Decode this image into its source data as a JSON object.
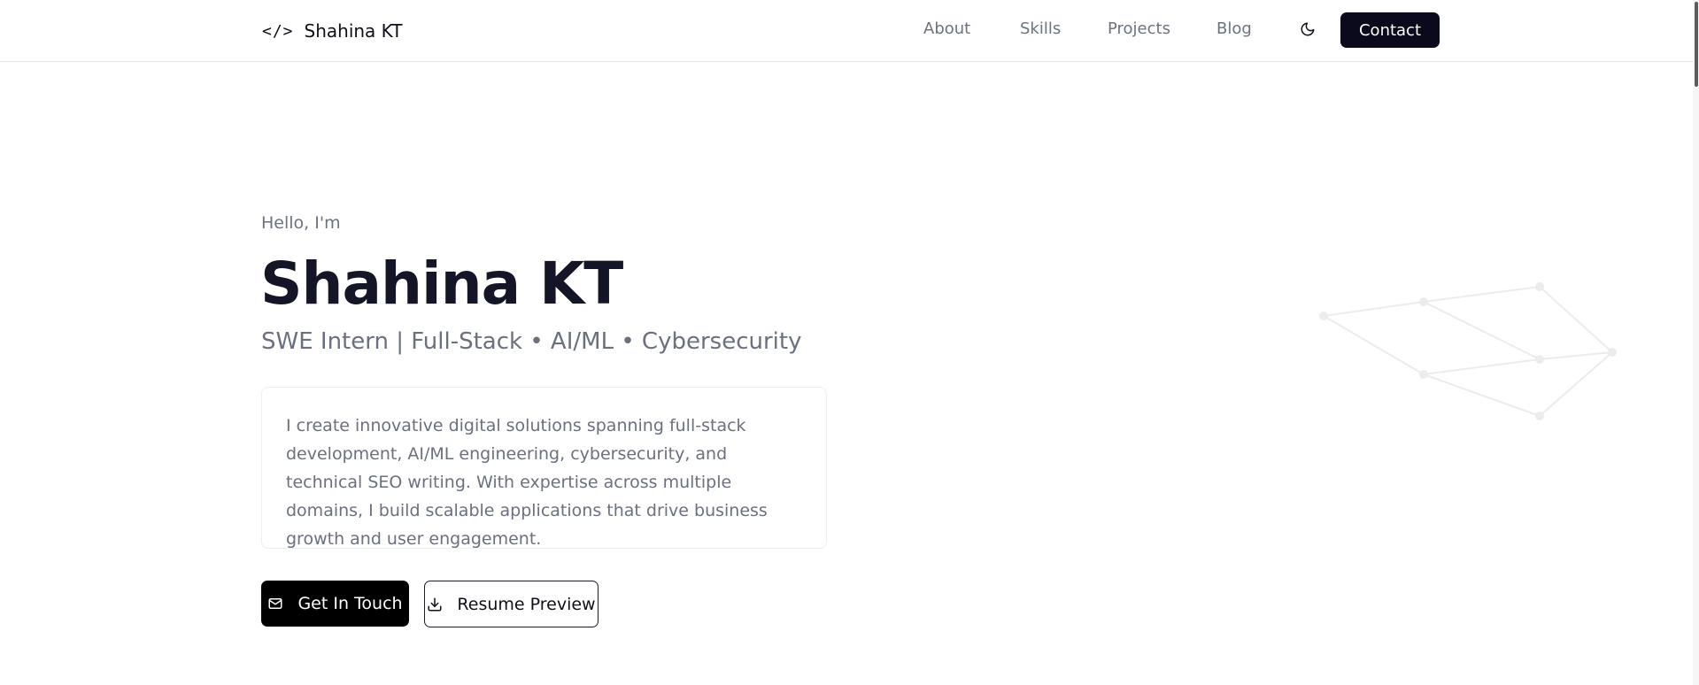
{
  "header": {
    "brand_mark": "</>",
    "brand_name": "Shahina KT",
    "nav": [
      "About",
      "Skills",
      "Projects",
      "Blog"
    ],
    "theme_icon": "moon-icon",
    "contact_label": "Contact"
  },
  "hero": {
    "greeting": "Hello, I'm",
    "name": "Shahina KT",
    "role": "SWE Intern | Full-Stack • AI/ML • Cybersecurity",
    "intro": "I create innovative digital solutions spanning full-stack development, AI/ML engineering, cybersecurity, and technical SEO writing. With expertise across multiple domains, I build scalable applications that drive business growth and user engagement.",
    "primary_button": {
      "label": "Get In Touch",
      "icon": "mail-icon"
    },
    "secondary_button": {
      "label": "Resume Preview",
      "icon": "download-icon"
    }
  },
  "colors": {
    "accent_dark": "#0b0a1c",
    "text_muted": "#6b7080",
    "heading": "#151528",
    "border": "#e6e7eb"
  }
}
